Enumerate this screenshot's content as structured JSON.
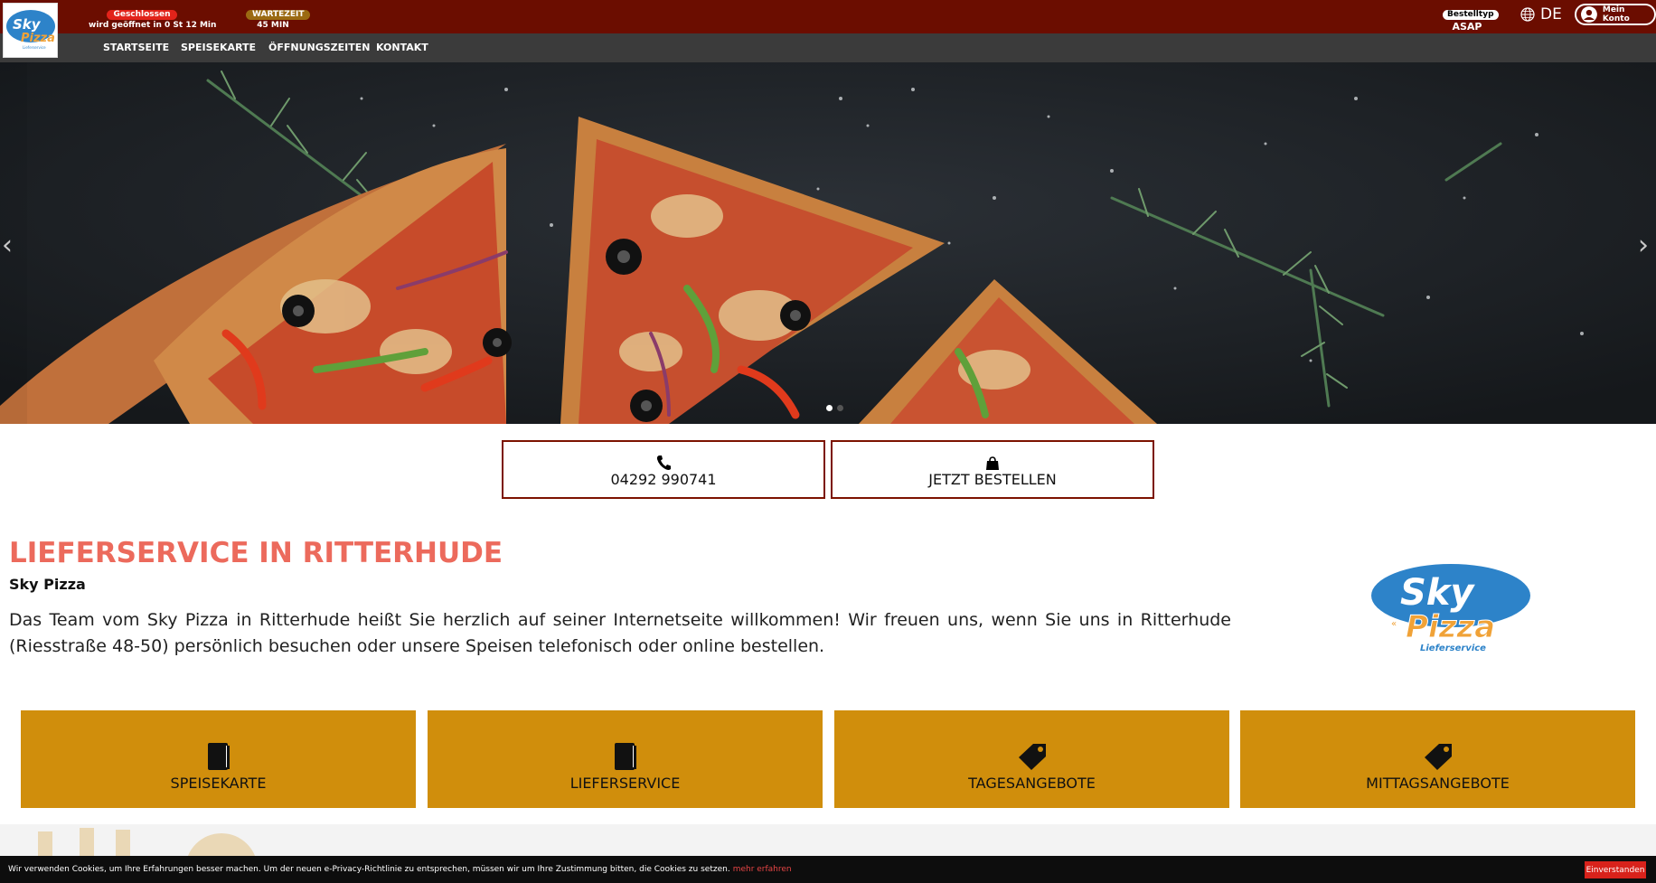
{
  "header": {
    "status_badge": "Geschlossen",
    "status_text": "wird geöffnet in 0 St 12 Min",
    "wait_badge": "WARTEZEIT",
    "wait_time": "45 MIN",
    "order_type_badge": "Bestelltyp",
    "order_type_value": "ASAP",
    "language": "DE",
    "account_label": "Mein Konto"
  },
  "logo": {
    "line1": "Sky",
    "line2": "Pizza",
    "line3": "Lieferservice"
  },
  "nav": {
    "items": [
      "STARTSEITE",
      "SPEISEKARTE",
      "ÖFFNUNGSZEITEN",
      "KONTAKT"
    ]
  },
  "hero": {
    "slide_count": 2,
    "active_slide": 1
  },
  "cta": {
    "phone": "04292 990741",
    "order": "JETZT BESTELLEN"
  },
  "intro": {
    "title": "LIEFERSERVICE IN RITTERHUDE",
    "subtitle": "Sky Pizza",
    "text": "Das Team vom Sky Pizza in Ritterhude heißt Sie herzlich auf seiner Internetseite willkommen! Wir freuen uns, wenn Sie uns in Ritterhude (Riesstraße 48-50) persönlich besuchen oder unsere Speisen telefonisch oder online bestellen."
  },
  "tiles": [
    {
      "label": "SPEISEKARTE",
      "icon": "book-icon"
    },
    {
      "label": "LIEFERSERVICE",
      "icon": "book-icon"
    },
    {
      "label": "TAGESANGEBOTE",
      "icon": "tag-icon"
    },
    {
      "label": "MITTAGSANGEBOTE",
      "icon": "tag-icon"
    }
  ],
  "cookie": {
    "text": "Wir verwenden Cookies, um Ihre Erfahrungen besser machen. Um der neuen e-Privacy-Richtlinie zu entsprechen, müssen wir um Ihre Zustimmung bitten, die Cookies zu setzen.",
    "link": "mehr erfahren",
    "button": "Einverstanden"
  },
  "colors": {
    "topbar": "#6b0d00",
    "navbar": "#3b3b3b",
    "title": "#ec6a5c",
    "tile": "#d08e0c",
    "cta_border": "#7c1200"
  }
}
